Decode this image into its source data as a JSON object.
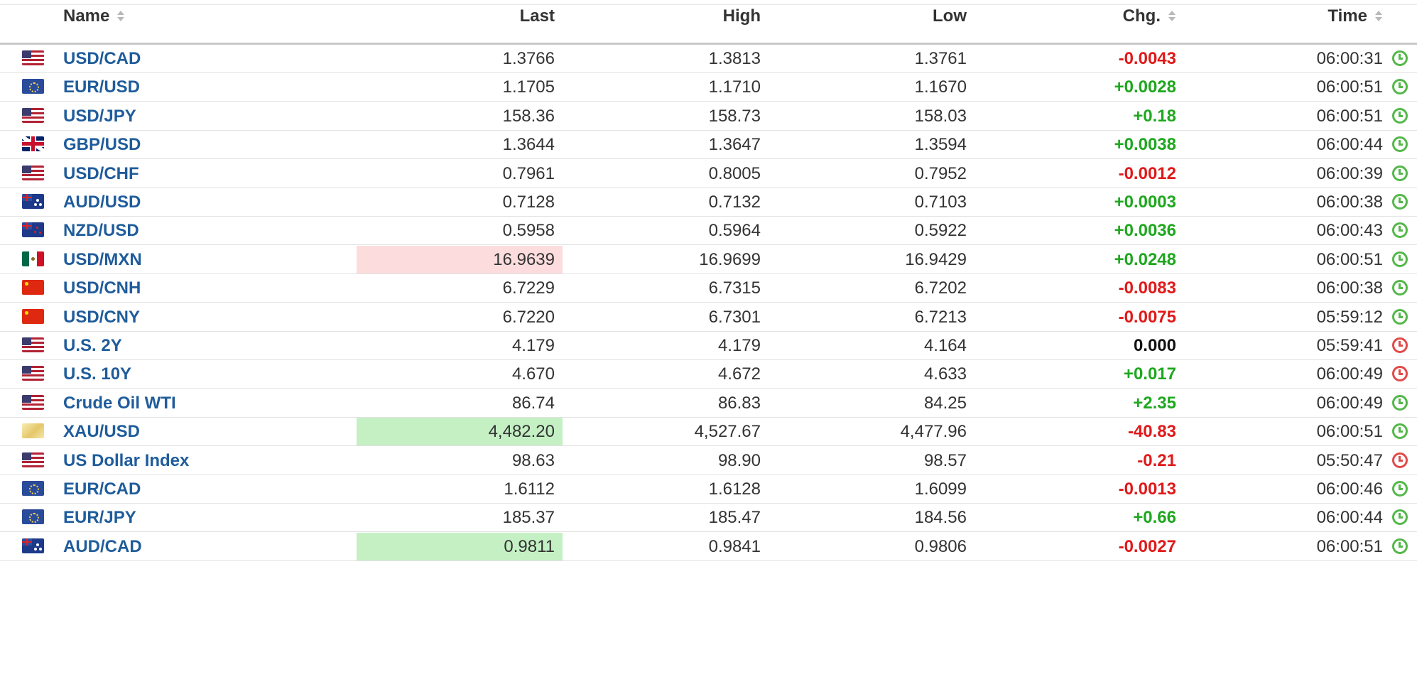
{
  "table": {
    "columns": {
      "name": "Name",
      "last": "Last",
      "high": "High",
      "low": "Low",
      "chg": "Chg.",
      "time": "Time"
    },
    "rows": [
      {
        "flag": "us-flag-icon",
        "name": "USD/CAD",
        "last": "1.3766",
        "high": "1.3813",
        "low": "1.3761",
        "chg": "-0.0043",
        "dir": "neg",
        "time": "06:00:31",
        "status": "open",
        "highlight": ""
      },
      {
        "flag": "eu-flag-icon",
        "name": "EUR/USD",
        "last": "1.1705",
        "high": "1.1710",
        "low": "1.1670",
        "chg": "+0.0028",
        "dir": "pos",
        "time": "06:00:51",
        "status": "open",
        "highlight": ""
      },
      {
        "flag": "us-flag-icon",
        "name": "USD/JPY",
        "last": "158.36",
        "high": "158.73",
        "low": "158.03",
        "chg": "+0.18",
        "dir": "pos",
        "time": "06:00:51",
        "status": "open",
        "highlight": ""
      },
      {
        "flag": "gb-flag-icon",
        "name": "GBP/USD",
        "last": "1.3644",
        "high": "1.3647",
        "low": "1.3594",
        "chg": "+0.0038",
        "dir": "pos",
        "time": "06:00:44",
        "status": "open",
        "highlight": ""
      },
      {
        "flag": "us-flag-icon",
        "name": "USD/CHF",
        "last": "0.7961",
        "high": "0.8005",
        "low": "0.7952",
        "chg": "-0.0012",
        "dir": "neg",
        "time": "06:00:39",
        "status": "open",
        "highlight": ""
      },
      {
        "flag": "au-flag-icon",
        "name": "AUD/USD",
        "last": "0.7128",
        "high": "0.7132",
        "low": "0.7103",
        "chg": "+0.0003",
        "dir": "pos",
        "time": "06:00:38",
        "status": "open",
        "highlight": ""
      },
      {
        "flag": "nz-flag-icon",
        "name": "NZD/USD",
        "last": "0.5958",
        "high": "0.5964",
        "low": "0.5922",
        "chg": "+0.0036",
        "dir": "pos",
        "time": "06:00:43",
        "status": "open",
        "highlight": ""
      },
      {
        "flag": "mx-flag-icon",
        "name": "USD/MXN",
        "last": "16.9639",
        "high": "16.9699",
        "low": "16.9429",
        "chg": "+0.0248",
        "dir": "pos",
        "time": "06:00:51",
        "status": "open",
        "highlight": "red"
      },
      {
        "flag": "cn-flag-icon",
        "name": "USD/CNH",
        "last": "6.7229",
        "high": "6.7315",
        "low": "6.7202",
        "chg": "-0.0083",
        "dir": "neg",
        "time": "06:00:38",
        "status": "open",
        "highlight": ""
      },
      {
        "flag": "cn-flag-icon",
        "name": "USD/CNY",
        "last": "6.7220",
        "high": "6.7301",
        "low": "6.7213",
        "chg": "-0.0075",
        "dir": "neg",
        "time": "05:59:12",
        "status": "open",
        "highlight": ""
      },
      {
        "flag": "us-flag-icon",
        "name": "U.S. 2Y",
        "last": "4.179",
        "high": "4.179",
        "low": "4.164",
        "chg": "0.000",
        "dir": "zero",
        "time": "05:59:41",
        "status": "closed",
        "highlight": ""
      },
      {
        "flag": "us-flag-icon",
        "name": "U.S. 10Y",
        "last": "4.670",
        "high": "4.672",
        "low": "4.633",
        "chg": "+0.017",
        "dir": "pos",
        "time": "06:00:49",
        "status": "closed",
        "highlight": ""
      },
      {
        "flag": "us-flag-icon",
        "name": "Crude Oil WTI",
        "last": "86.74",
        "high": "86.83",
        "low": "84.25",
        "chg": "+2.35",
        "dir": "pos",
        "time": "06:00:49",
        "status": "open",
        "highlight": ""
      },
      {
        "flag": "gold-icon",
        "name": "XAU/USD",
        "last": "4,482.20",
        "high": "4,527.67",
        "low": "4,477.96",
        "chg": "-40.83",
        "dir": "neg",
        "time": "06:00:51",
        "status": "open",
        "highlight": "green"
      },
      {
        "flag": "us-flag-icon",
        "name": "US Dollar Index",
        "last": "98.63",
        "high": "98.90",
        "low": "98.57",
        "chg": "-0.21",
        "dir": "neg",
        "time": "05:50:47",
        "status": "closed",
        "highlight": ""
      },
      {
        "flag": "eu-flag-icon",
        "name": "EUR/CAD",
        "last": "1.6112",
        "high": "1.6128",
        "low": "1.6099",
        "chg": "-0.0013",
        "dir": "neg",
        "time": "06:00:46",
        "status": "open",
        "highlight": ""
      },
      {
        "flag": "eu-flag-icon",
        "name": "EUR/JPY",
        "last": "185.37",
        "high": "185.47",
        "low": "184.56",
        "chg": "+0.66",
        "dir": "pos",
        "time": "06:00:44",
        "status": "open",
        "highlight": ""
      },
      {
        "flag": "au-flag-icon",
        "name": "AUD/CAD",
        "last": "0.9811",
        "high": "0.9841",
        "low": "0.9806",
        "chg": "-0.0027",
        "dir": "neg",
        "time": "06:00:51",
        "status": "open",
        "highlight": "green"
      }
    ]
  },
  "colors": {
    "link": "#1f5c9b",
    "positive": "#1ea71e",
    "negative": "#e01919",
    "highlight_up": "#c4f0c4",
    "highlight_down": "#fcdcdc",
    "clock_open": "#54b84a",
    "clock_closed": "#e24a4a"
  }
}
